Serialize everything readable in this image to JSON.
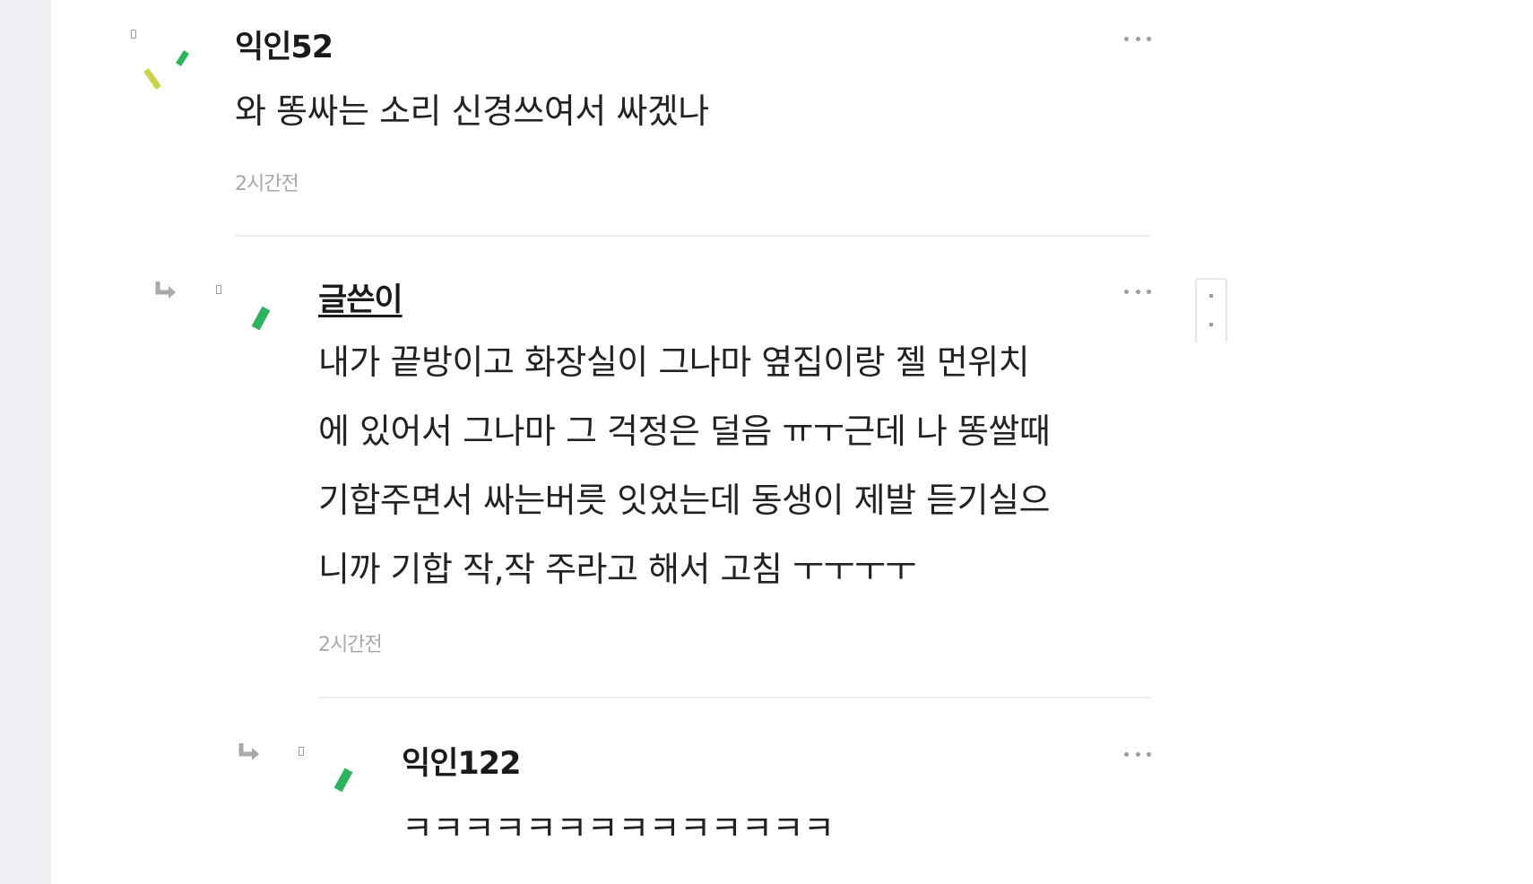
{
  "comments": [
    {
      "nickname": "익인52",
      "text": "와 똥싸는 소리 신경쓰여서 싸겠나",
      "time": "2시간전",
      "is_author": false,
      "avatar_icon": "green-dashes-avatar-icon"
    },
    {
      "nickname": "글쓴이",
      "text_lines": [
        "내가 끝방이고 화장실이 그나마 옆집이랑 젤 먼위치",
        "에 있어서 그나마 그 걱정은 덜음 ㅠㅜ근데 나 똥쌀때",
        "기합주면서 싸는버릇 잇었는데 동생이 제발 듣기실으",
        "니까 기합 작,작 주라고 해서 고침 ㅜㅜㅜㅜ"
      ],
      "time": "2시간전",
      "is_author": true,
      "avatar_icon": "green-slash-avatar-icon"
    },
    {
      "nickname": "익인122",
      "text": "ㅋㅋㅋㅋㅋㅋㅋㅋㅋㅋㅋㅋㅋㅋ",
      "is_author": false,
      "avatar_icon": "green-slash-avatar-icon"
    }
  ],
  "icons": {
    "more": "more-options-icon",
    "reply": "reply-arrow-icon",
    "badge": "level-badge-icon"
  },
  "colors": {
    "avatar_green": "#2db35d",
    "avatar_yellow": "#c9d44a",
    "timestamp": "#a8a8a8",
    "gutter": "#eef0f3"
  }
}
